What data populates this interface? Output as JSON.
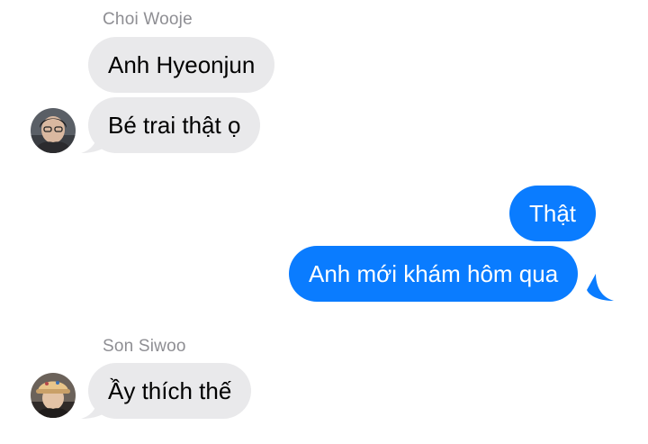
{
  "colors": {
    "incoming_bubble": "#e9e9eb",
    "outgoing_bubble": "#0a7cff",
    "sender_name": "#8e8e93"
  },
  "messages": [
    {
      "sender": "Choi Wooje",
      "direction": "incoming",
      "texts": [
        "Anh Hyeonjun",
        "Bé trai thật ọ"
      ]
    },
    {
      "sender": "",
      "direction": "outgoing",
      "texts": [
        "Thật",
        "Anh mới khám hôm qua"
      ]
    },
    {
      "sender": "Son Siwoo",
      "direction": "incoming",
      "texts": [
        "Ầy thích thế"
      ]
    }
  ],
  "avatars": {
    "choi_wooje": "person-photo-avatar",
    "son_siwoo": "person-photo-avatar-with-hat"
  }
}
